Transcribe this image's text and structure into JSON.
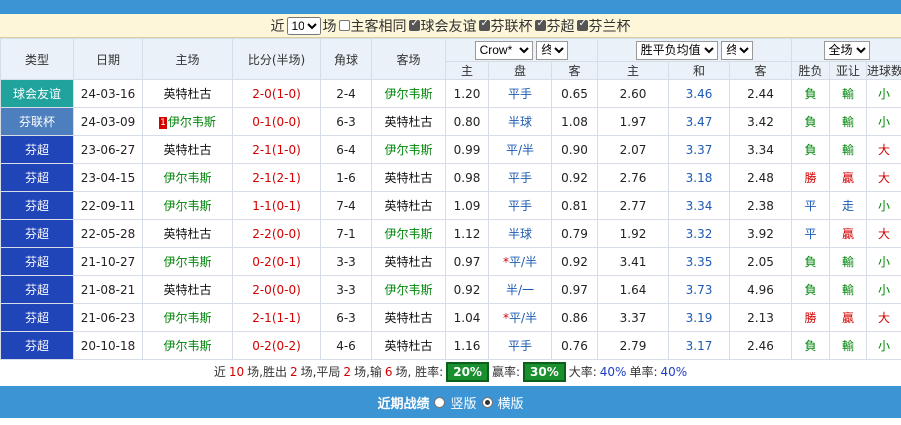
{
  "filter": {
    "prefix": "近",
    "count": "10",
    "suffix": "场",
    "options": [
      {
        "label": "主客相同",
        "checked": false
      },
      {
        "label": "球会友谊",
        "checked": true
      },
      {
        "label": "芬联杯",
        "checked": true
      },
      {
        "label": "芬超",
        "checked": true
      },
      {
        "label": "芬兰杯",
        "checked": true
      }
    ]
  },
  "headers": {
    "type": "类型",
    "date": "日期",
    "home": "主场",
    "score": "比分(半场)",
    "corner": "角球",
    "away": "客场",
    "company_select": "Crow*",
    "odds_select1": "终",
    "avg_select": "胜平负均值",
    "odds_select2": "终",
    "range_select": "全场",
    "sub": {
      "h1": "主",
      "pan": "盘",
      "a1": "客",
      "h2": "主",
      "draw": "和",
      "a2": "客",
      "wl": "胜负",
      "ah": "亚让",
      "ou": "进球数"
    }
  },
  "rows": [
    {
      "type": "球会友谊",
      "tclass": "t-friendly",
      "date": "24-03-16",
      "home": "英特杜古",
      "hcolor": "home",
      "htag": "",
      "score": "2-0",
      "half": "(1-0)",
      "corner": "2-4",
      "away": "伊尔韦斯",
      "acolor": "green",
      "h1": "1.20",
      "pan": "平手",
      "a1": "0.65",
      "h2": "2.60",
      "d": "3.46",
      "a2": "2.44",
      "wl": "負",
      "wlc": "green",
      "ah": "輸",
      "ahc": "green",
      "ou": "小",
      "ouc": "green"
    },
    {
      "type": "芬联杯",
      "tclass": "t-cup",
      "date": "24-03-09",
      "home": "伊尔韦斯",
      "hcolor": "green",
      "htag": "1",
      "score": "0-1",
      "half": "(0-0)",
      "corner": "6-3",
      "away": "英特杜古",
      "acolor": "home",
      "h1": "0.80",
      "pan": "半球",
      "a1": "1.08",
      "h2": "1.97",
      "d": "3.47",
      "a2": "3.42",
      "wl": "負",
      "wlc": "green",
      "ah": "輸",
      "ahc": "green",
      "ou": "小",
      "ouc": "green"
    },
    {
      "type": "芬超",
      "tclass": "t-super",
      "date": "23-06-27",
      "home": "英特杜古",
      "hcolor": "home",
      "htag": "",
      "score": "2-1",
      "half": "(1-0)",
      "corner": "6-4",
      "away": "伊尔韦斯",
      "acolor": "green",
      "h1": "0.99",
      "pan": "平/半",
      "a1": "0.90",
      "h2": "2.07",
      "d": "3.37",
      "a2": "3.34",
      "wl": "負",
      "wlc": "green",
      "ah": "輸",
      "ahc": "green",
      "ou": "大",
      "ouc": "red"
    },
    {
      "type": "芬超",
      "tclass": "t-super",
      "date": "23-04-15",
      "home": "伊尔韦斯",
      "hcolor": "green",
      "htag": "",
      "score": "2-1",
      "half": "(2-1)",
      "corner": "1-6",
      "away": "英特杜古",
      "acolor": "home",
      "h1": "0.98",
      "pan": "平手",
      "a1": "0.92",
      "h2": "2.76",
      "d": "3.18",
      "a2": "2.48",
      "wl": "勝",
      "wlc": "red",
      "ah": "贏",
      "ahc": "red",
      "ou": "大",
      "ouc": "red"
    },
    {
      "type": "芬超",
      "tclass": "t-super",
      "date": "22-09-11",
      "home": "伊尔韦斯",
      "hcolor": "green",
      "htag": "",
      "score": "1-1",
      "half": "(0-1)",
      "corner": "7-4",
      "away": "英特杜古",
      "acolor": "home",
      "h1": "1.09",
      "pan": "平手",
      "a1": "0.81",
      "h2": "2.77",
      "d": "3.34",
      "a2": "2.38",
      "wl": "平",
      "wlc": "blue",
      "ah": "走",
      "ahc": "blue",
      "ou": "小",
      "ouc": "green"
    },
    {
      "type": "芬超",
      "tclass": "t-super",
      "date": "22-05-28",
      "home": "英特杜古",
      "hcolor": "home",
      "htag": "",
      "score": "2-2",
      "half": "(0-0)",
      "corner": "7-1",
      "away": "伊尔韦斯",
      "acolor": "green",
      "h1": "1.12",
      "pan": "半球",
      "a1": "0.79",
      "h2": "1.92",
      "d": "3.32",
      "a2": "3.92",
      "wl": "平",
      "wlc": "blue",
      "ah": "贏",
      "ahc": "red",
      "ou": "大",
      "ouc": "red"
    },
    {
      "type": "芬超",
      "tclass": "t-super",
      "date": "21-10-27",
      "home": "伊尔韦斯",
      "hcolor": "green",
      "htag": "",
      "score": "0-2",
      "half": "(0-1)",
      "corner": "3-3",
      "away": "英特杜古",
      "acolor": "home",
      "h1": "0.97",
      "pan": "*平/半",
      "a1": "0.92",
      "h2": "3.41",
      "d": "3.35",
      "a2": "2.05",
      "wl": "負",
      "wlc": "green",
      "ah": "輸",
      "ahc": "green",
      "ou": "小",
      "ouc": "green"
    },
    {
      "type": "芬超",
      "tclass": "t-super",
      "date": "21-08-21",
      "home": "英特杜古",
      "hcolor": "home",
      "htag": "",
      "score": "2-0",
      "half": "(0-0)",
      "corner": "3-3",
      "away": "伊尔韦斯",
      "acolor": "green",
      "h1": "0.92",
      "pan": "半/一",
      "a1": "0.97",
      "h2": "1.64",
      "d": "3.73",
      "a2": "4.96",
      "wl": "負",
      "wlc": "green",
      "ah": "輸",
      "ahc": "green",
      "ou": "小",
      "ouc": "green"
    },
    {
      "type": "芬超",
      "tclass": "t-super",
      "date": "21-06-23",
      "home": "伊尔韦斯",
      "hcolor": "green",
      "htag": "",
      "score": "2-1",
      "half": "(1-1)",
      "corner": "6-3",
      "away": "英特杜古",
      "acolor": "home",
      "h1": "1.04",
      "pan": "*平/半",
      "a1": "0.86",
      "h2": "3.37",
      "d": "3.19",
      "a2": "2.13",
      "wl": "勝",
      "wlc": "red",
      "ah": "贏",
      "ahc": "red",
      "ou": "大",
      "ouc": "red"
    },
    {
      "type": "芬超",
      "tclass": "t-super",
      "date": "20-10-18",
      "home": "伊尔韦斯",
      "hcolor": "green",
      "htag": "",
      "score": "0-2",
      "half": "(0-2)",
      "corner": "4-6",
      "away": "英特杜古",
      "acolor": "home",
      "h1": "1.16",
      "pan": "平手",
      "a1": "0.76",
      "h2": "2.79",
      "d": "3.17",
      "a2": "2.46",
      "wl": "負",
      "wlc": "green",
      "ah": "輸",
      "ahc": "green",
      "ou": "小",
      "ouc": "green"
    }
  ],
  "summary": {
    "p1": "近",
    "n1": "10",
    "p2": "场,胜出",
    "n2": "2",
    "p3": "场,平局",
    "n3": "2",
    "p4": "场,输",
    "n4": "6",
    "p5": "场, 胜率:",
    "win_rate": "20%",
    "p6": "赢率:",
    "cover_rate": "30%",
    "p7": "大率:",
    "over_rate": "40%",
    "p8": "单率:",
    "odd_rate": "40%"
  },
  "bottom": {
    "title": "近期战绩",
    "opt1": "竖版",
    "opt2": "横版"
  }
}
